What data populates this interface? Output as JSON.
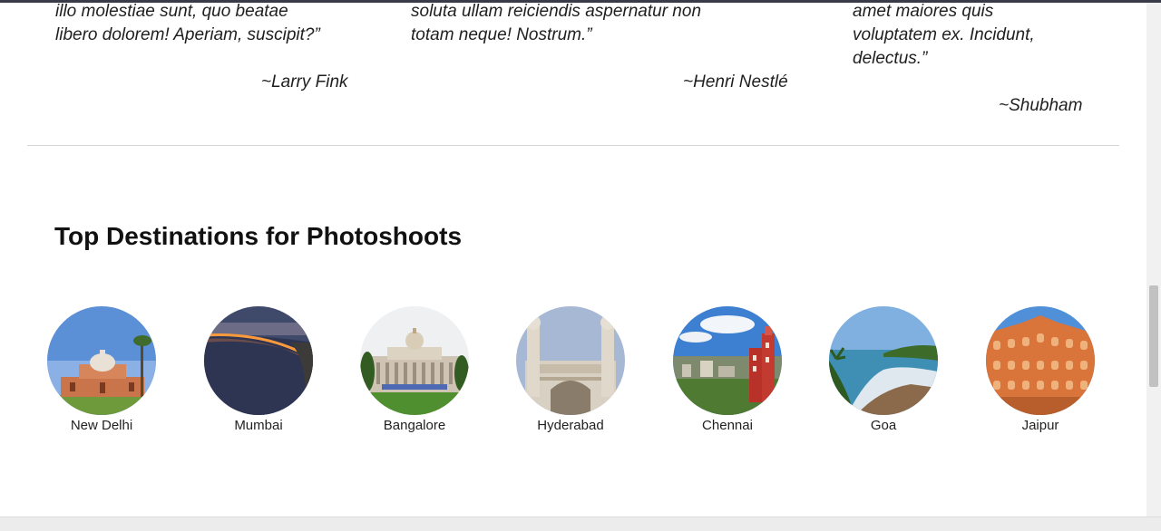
{
  "testimonials": [
    {
      "lines": [
        "illo molestiae sunt, quo beatae",
        "libero dolorem! Aperiam, suscipit?”"
      ],
      "author": "~Larry Fink"
    },
    {
      "lines": [
        "soluta ullam reiciendis aspernatur non",
        "totam neque! Nostrum.”"
      ],
      "author": "~Henri Nestlé"
    },
    {
      "lines": [
        "amet maiores quis",
        "voluptatem ex. Incidunt,",
        "delectus.”"
      ],
      "author": "~Shubham"
    }
  ],
  "destinations_section": {
    "title": "Top Destinations for Photoshoots",
    "items": [
      {
        "name": "New Delhi",
        "icon": "monument-photo"
      },
      {
        "name": "Mumbai",
        "icon": "seafront-photo"
      },
      {
        "name": "Bangalore",
        "icon": "vidhana-soudha-photo"
      },
      {
        "name": "Hyderabad",
        "icon": "charminar-photo"
      },
      {
        "name": "Chennai",
        "icon": "city-photo"
      },
      {
        "name": "Goa",
        "icon": "beach-photo"
      },
      {
        "name": "Jaipur",
        "icon": "hawa-mahal-photo"
      }
    ]
  },
  "colors": {
    "text": "#1a1a1a",
    "divider": "#d6d6d6",
    "scrollbar_thumb": "#c1c1c1"
  }
}
